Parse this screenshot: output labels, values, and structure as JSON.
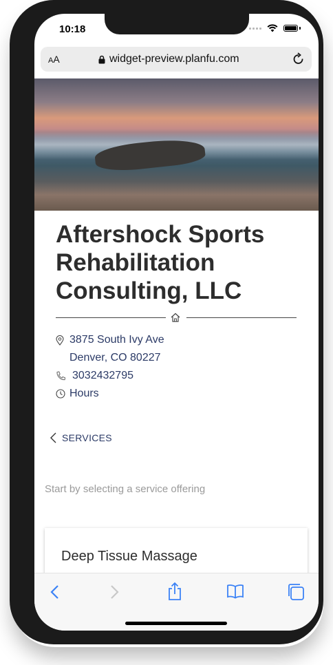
{
  "status_bar": {
    "time": "10:18"
  },
  "browser": {
    "aa_label_small": "A",
    "aa_label_large": "A",
    "url": "widget-preview.planfu.com"
  },
  "business": {
    "name": "Aftershock Sports Rehabilitation Consulting, LLC",
    "address_line1": "3875 South Ivy Ave",
    "address_line2": "Denver, CO 80227",
    "phone": "3032432795",
    "hours_label": "Hours"
  },
  "services_nav": {
    "label": "SERVICES"
  },
  "instructions": "Start by selecting a service offering",
  "services": [
    {
      "name": "Deep Tissue Massage"
    }
  ],
  "colors": {
    "link": "#2b3a66",
    "accent_blue": "#3b82f6",
    "disabled": "#c8c8c8"
  }
}
